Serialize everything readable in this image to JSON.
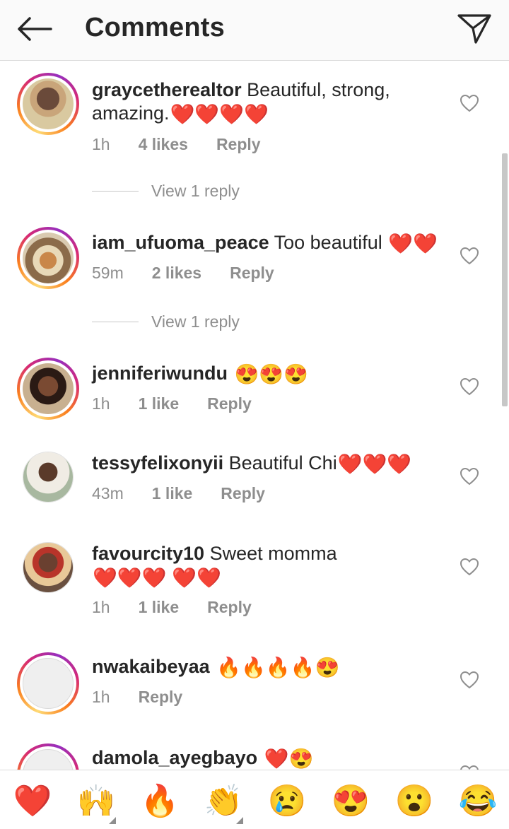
{
  "header": {
    "title": "Comments",
    "back_icon": "back-arrow-icon",
    "share_icon": "send-icon"
  },
  "colors": {
    "like_red": "#e0162b",
    "meta_gray": "#8e8e8e",
    "text": "#262626"
  },
  "comments": [
    {
      "username": "graycetherealtor",
      "text": "Beautiful, strong, amazing.",
      "hearts": "❤️❤️❤️❤️",
      "time": "1h",
      "likes": "4 likes",
      "reply": "Reply",
      "view_replies": "View 1 reply"
    },
    {
      "username": "iam_ufuoma_peace",
      "text": "Too beautiful",
      "hearts": "❤️❤️",
      "time": "59m",
      "likes": "2 likes",
      "reply": "Reply",
      "view_replies": "View 1 reply"
    },
    {
      "username": "jenniferiwundu",
      "text": "",
      "hearts": "😍😍😍",
      "time": "1h",
      "likes": "1 like",
      "reply": "Reply"
    },
    {
      "username": "tessyfelixonyii",
      "text": "Beautiful Chi",
      "hearts": "❤️❤️❤️",
      "time": "43m",
      "likes": "1 like",
      "reply": "Reply"
    },
    {
      "username": "favourcity10",
      "text": "Sweet momma",
      "hearts": "❤️❤️❤️ ❤️❤️",
      "time": "1h",
      "likes": "1 like",
      "reply": "Reply"
    },
    {
      "username": "nwakaibeyaa",
      "text": "",
      "hearts": "🔥🔥🔥🔥😍",
      "time": "1h",
      "likes": "",
      "reply": "Reply"
    },
    {
      "username": "damola_ayegbayo",
      "text": "",
      "hearts": "❤️😍"
    }
  ],
  "emoji_bar": [
    "❤️",
    "🙌",
    "🔥",
    "👏",
    "😢",
    "😍",
    "😮",
    "😂"
  ]
}
